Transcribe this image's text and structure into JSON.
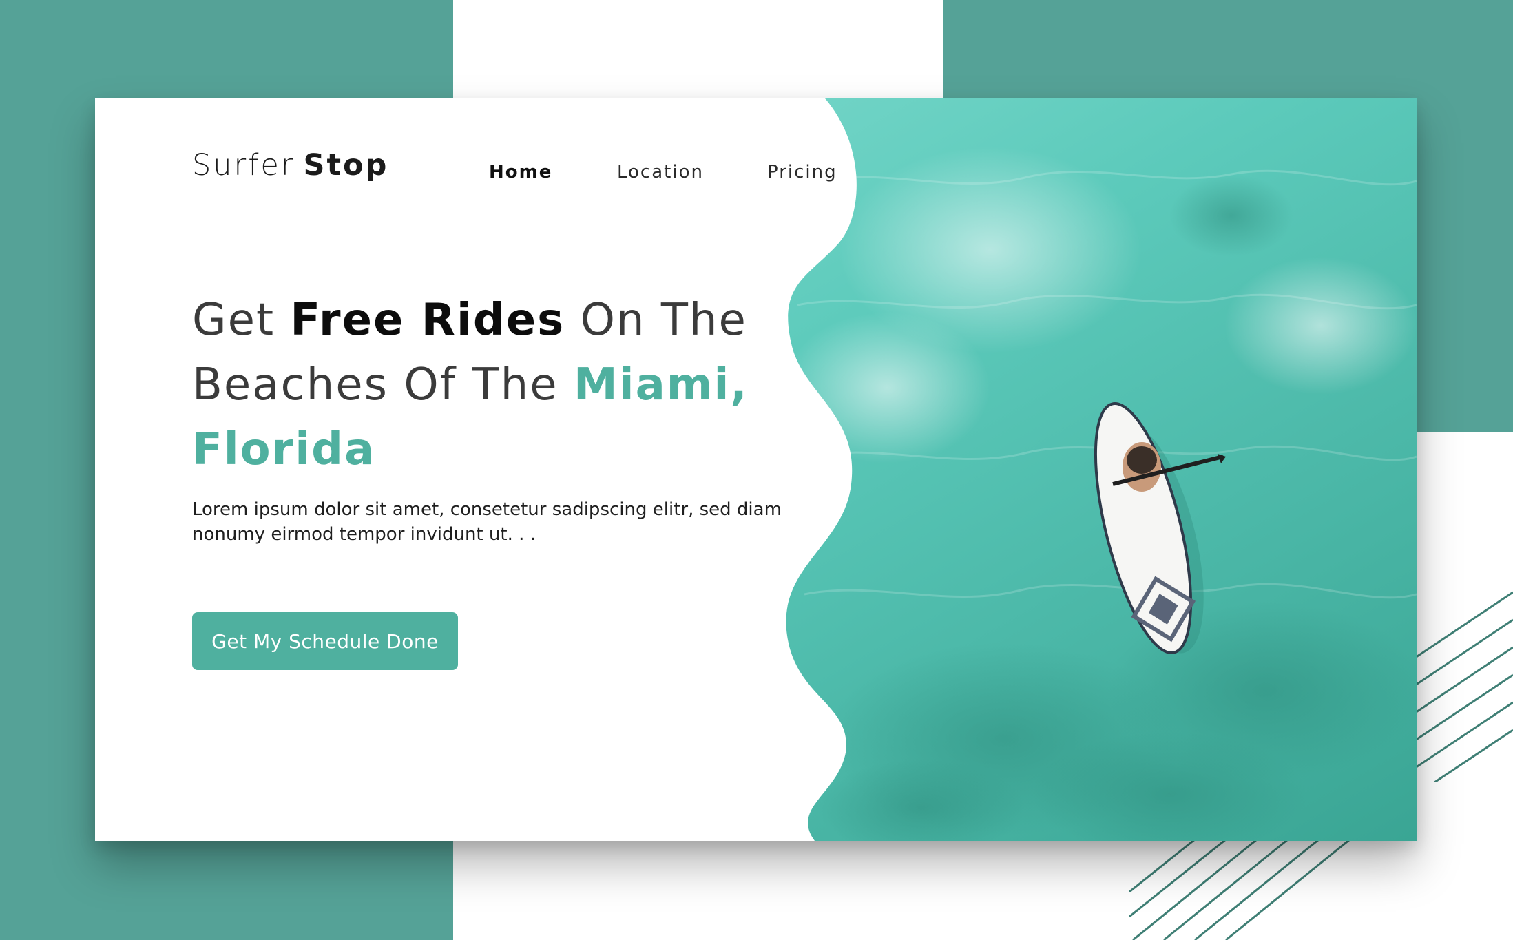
{
  "colors": {
    "accent": "#4fb09f",
    "background_teal": "#55a297",
    "water_light": "#7fdcd0",
    "water_dark": "#2f9e8f",
    "text_dark": "#1b1b1b"
  },
  "brand": {
    "name_light": "Surfer",
    "name_bold": "Stop"
  },
  "nav": {
    "items": [
      {
        "label": "Home"
      },
      {
        "label": "Location"
      },
      {
        "label": "Pricing"
      }
    ],
    "active": "Home"
  },
  "hero": {
    "headline": {
      "part1": "Get ",
      "part2_bold": "Free Rides",
      "part3": " On The Beaches Of The ",
      "part4_accent": "Miami, Florida"
    },
    "description": "Lorem ipsum dolor sit amet, consetetur sadipscing elitr, sed diam nonumy eirmod tempor invidunt ut. . .",
    "cta_label": "Get My Schedule Done",
    "image_icon": "paddleboard-photo-icon"
  }
}
